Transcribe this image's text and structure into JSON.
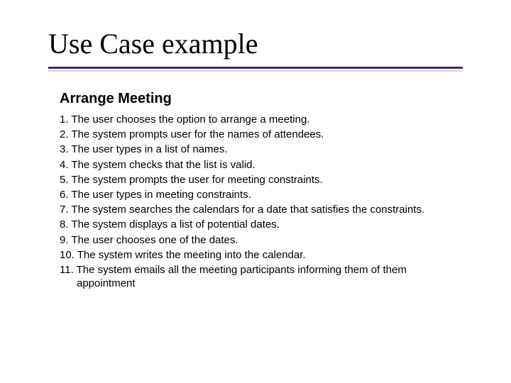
{
  "title": "Use Case example",
  "subheading": "Arrange Meeting",
  "steps": [
    "1. The user chooses the option to arrange a meeting.",
    "2. The system prompts user for the names of attendees.",
    "3. The user types in a list of names.",
    "4. The system checks that the list is valid.",
    "5. The system prompts the user for meeting constraints.",
    "6. The user types in meeting constraints.",
    "7. The system searches the calendars for a date that satisfies the constraints.",
    "8. The system displays a list of potential dates.",
    "9. The user chooses one of the dates.",
    "10. The system writes the meeting into the calendar.",
    "11. The system emails all the meeting participants informing them of them appointment"
  ]
}
